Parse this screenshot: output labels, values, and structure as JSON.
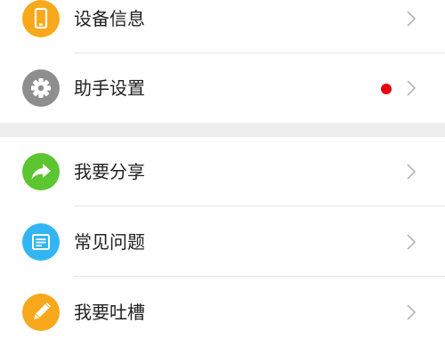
{
  "menu": {
    "group1": [
      {
        "label": "设备信息",
        "icon": "phone-icon",
        "color": "#f7a81b"
      },
      {
        "label": "助手设置",
        "icon": "gear-icon",
        "color": "#8e8e8e",
        "badge": true,
        "badge_color": "#e60012"
      }
    ],
    "group2": [
      {
        "label": "我要分享",
        "icon": "share-icon",
        "color": "#5cc631"
      },
      {
        "label": "常见问题",
        "icon": "faq-icon",
        "color": "#31b6f3"
      },
      {
        "label": "我要吐槽",
        "icon": "pencil-icon",
        "color": "#f7a81b"
      }
    ]
  },
  "colors": {
    "chevron": "#b5b5b5",
    "divider": "#e5e5e5",
    "section_gap": "#eeeeee"
  }
}
